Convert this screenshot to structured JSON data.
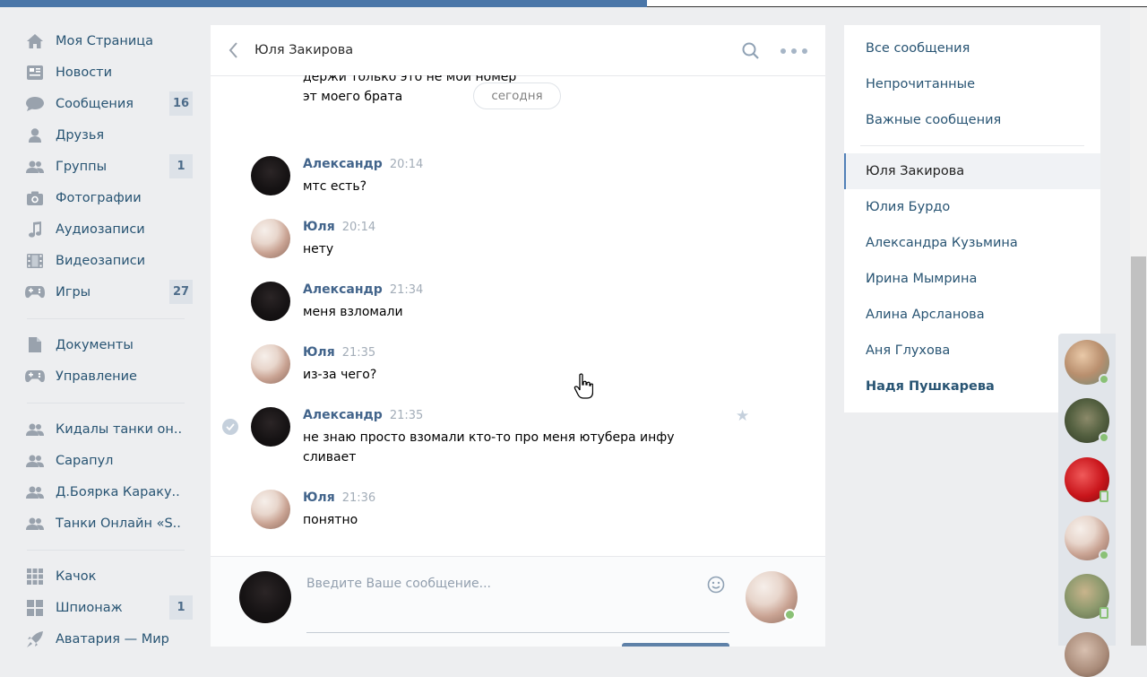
{
  "left_nav": {
    "main": [
      {
        "label": "Моя Страница",
        "icon": "home-icon"
      },
      {
        "label": "Новости",
        "icon": "news-icon"
      },
      {
        "label": "Сообщения",
        "icon": "messages-icon",
        "count": "16"
      },
      {
        "label": "Друзья",
        "icon": "friends-icon"
      },
      {
        "label": "Группы",
        "icon": "groups-icon",
        "count": "1"
      },
      {
        "label": "Фотографии",
        "icon": "camera-icon"
      },
      {
        "label": "Аудиозаписи",
        "icon": "music-icon"
      },
      {
        "label": "Видеозаписи",
        "icon": "video-icon"
      },
      {
        "label": "Игры",
        "icon": "gamepad-icon",
        "count": "27"
      }
    ],
    "tools": [
      {
        "label": "Документы",
        "icon": "document-icon"
      },
      {
        "label": "Управление",
        "icon": "gamepad-icon"
      }
    ],
    "groups": [
      {
        "label": "Кидалы танки он..",
        "icon": "group-icon"
      },
      {
        "label": "Сарапул",
        "icon": "group-icon"
      },
      {
        "label": "Д.Боярка Караку..",
        "icon": "group-icon"
      },
      {
        "label": "Танки Онлайн «S..",
        "icon": "group-icon"
      }
    ],
    "apps": [
      {
        "label": "Качок",
        "icon": "app-grid-icon"
      },
      {
        "label": "Шпионаж",
        "icon": "app-tiles-icon",
        "count": "1"
      },
      {
        "label": "Аватария — Мир",
        "icon": "rocket-icon"
      }
    ]
  },
  "chat": {
    "title": "Юля Закирова",
    "cut_line1": "держи только это не мой номер",
    "cut_line2": "эт моего брата",
    "date_divider": "сегодня",
    "messages": [
      {
        "author": "Александр",
        "time": "20:14",
        "text": "мтс есть?",
        "avatar": "dark"
      },
      {
        "author": "Юля",
        "time": "20:14",
        "text": "нету",
        "avatar": "yulia"
      },
      {
        "author": "Александр",
        "time": "21:34",
        "text": "меня взломали",
        "avatar": "dark"
      },
      {
        "author": "Юля",
        "time": "21:35",
        "text": "из-за чего?",
        "avatar": "yulia"
      },
      {
        "author": "Александр",
        "time": "21:35",
        "text": "не знаю просто взомали кто-то про меня ютубера инфу сливает",
        "avatar": "dark",
        "selected": true
      },
      {
        "author": "Юля",
        "time": "21:36",
        "text": "понятно",
        "avatar": "yulia"
      }
    ],
    "composer_placeholder": "Введите Ваше сообщение..."
  },
  "right_panel": {
    "filters": [
      "Все сообщения",
      "Непрочитанные",
      "Важные сообщения"
    ],
    "dialogs": [
      {
        "name": "Юля Закирова",
        "active": true
      },
      {
        "name": "Юлия Бурдо"
      },
      {
        "name": "Александра Кузьмина"
      },
      {
        "name": "Ирина Мымрина"
      },
      {
        "name": "Алина Арсланова"
      },
      {
        "name": "Аня Глухова"
      },
      {
        "name": "Надя Пушкарева",
        "unread": true
      }
    ]
  },
  "friends_bar": [
    {
      "status": "online"
    },
    {
      "status": "online"
    },
    {
      "status": "mobile"
    },
    {
      "status": "online"
    },
    {
      "status": "mobile"
    },
    {
      "status": "online"
    }
  ],
  "colors": {
    "brand": "#4a76a8",
    "link": "#285473",
    "author": "#42648b",
    "online": "#8ac176",
    "background": "#edeef0"
  }
}
